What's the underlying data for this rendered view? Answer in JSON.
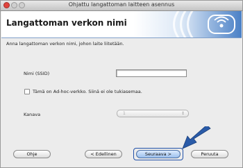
{
  "window": {
    "title": "Ohjattu langattoman laitteen asennus"
  },
  "banner": {
    "title": "Langattoman verkon nimi"
  },
  "main": {
    "instruction": "Anna langattoman verkon nimi, johon laite liitetään.",
    "ssid_label": "Nimi (SSID)",
    "ssid_value": "",
    "adhoc_label": "Tämä on Ad-hoc-verkko. Siinä ei ole tukiasemaa.",
    "adhoc_checked": false,
    "channel_label": "Kanava",
    "channel_value": "1"
  },
  "buttons": {
    "help": "Ohje",
    "back": "< Edellinen",
    "next": "Seuraava >",
    "cancel": "Peruuta"
  },
  "icons": {
    "logo": "wireless-logo-icon",
    "arrow": "pointer-arrow-icon"
  },
  "colors": {
    "banner_blue": "#4a80c6",
    "arrow_blue": "#2a5ba8",
    "close_red": "#e0443e"
  }
}
